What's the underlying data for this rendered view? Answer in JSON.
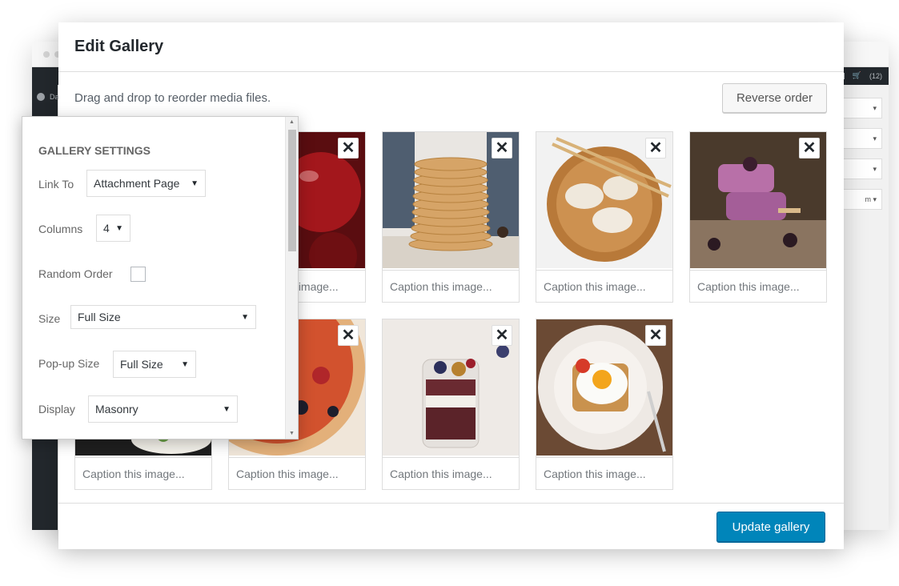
{
  "background": {
    "sidebar_label": "Da",
    "cart_count": "(12)",
    "select_hint": "m"
  },
  "modal": {
    "title": "Edit Gallery",
    "instructions": "Drag and drop to reorder media files.",
    "reverse_label": "Reverse order",
    "update_label": "Update gallery",
    "remove_glyph": "✕"
  },
  "images": [
    {
      "name": "apples",
      "caption_placeholder": "Caption this image..."
    },
    {
      "name": "pancakes",
      "caption_placeholder": "Caption this image..."
    },
    {
      "name": "dumplings",
      "caption_placeholder": "Caption this image..."
    },
    {
      "name": "popsicles",
      "caption_placeholder": "Caption this image..."
    },
    {
      "name": "salad",
      "caption_placeholder": "Caption this image..."
    },
    {
      "name": "pizza",
      "caption_placeholder": "Caption this image..."
    },
    {
      "name": "parfait",
      "caption_placeholder": "Caption this image..."
    },
    {
      "name": "fried-egg",
      "caption_placeholder": "Caption this image..."
    }
  ],
  "settings": {
    "heading": "Gallery Settings",
    "link_to_label": "Link To",
    "link_to_value": "Attachment Page",
    "columns_label": "Columns",
    "columns_value": "4",
    "random_label": "Random Order",
    "random_checked": false,
    "size_label": "Size",
    "size_value": "Full Size",
    "popup_label": "Pop-up Size",
    "popup_value": "Full Size",
    "display_label": "Display",
    "display_value": "Masonry"
  },
  "colors": {
    "primary_button": "#0085ba",
    "admin_dark": "#23282d"
  }
}
